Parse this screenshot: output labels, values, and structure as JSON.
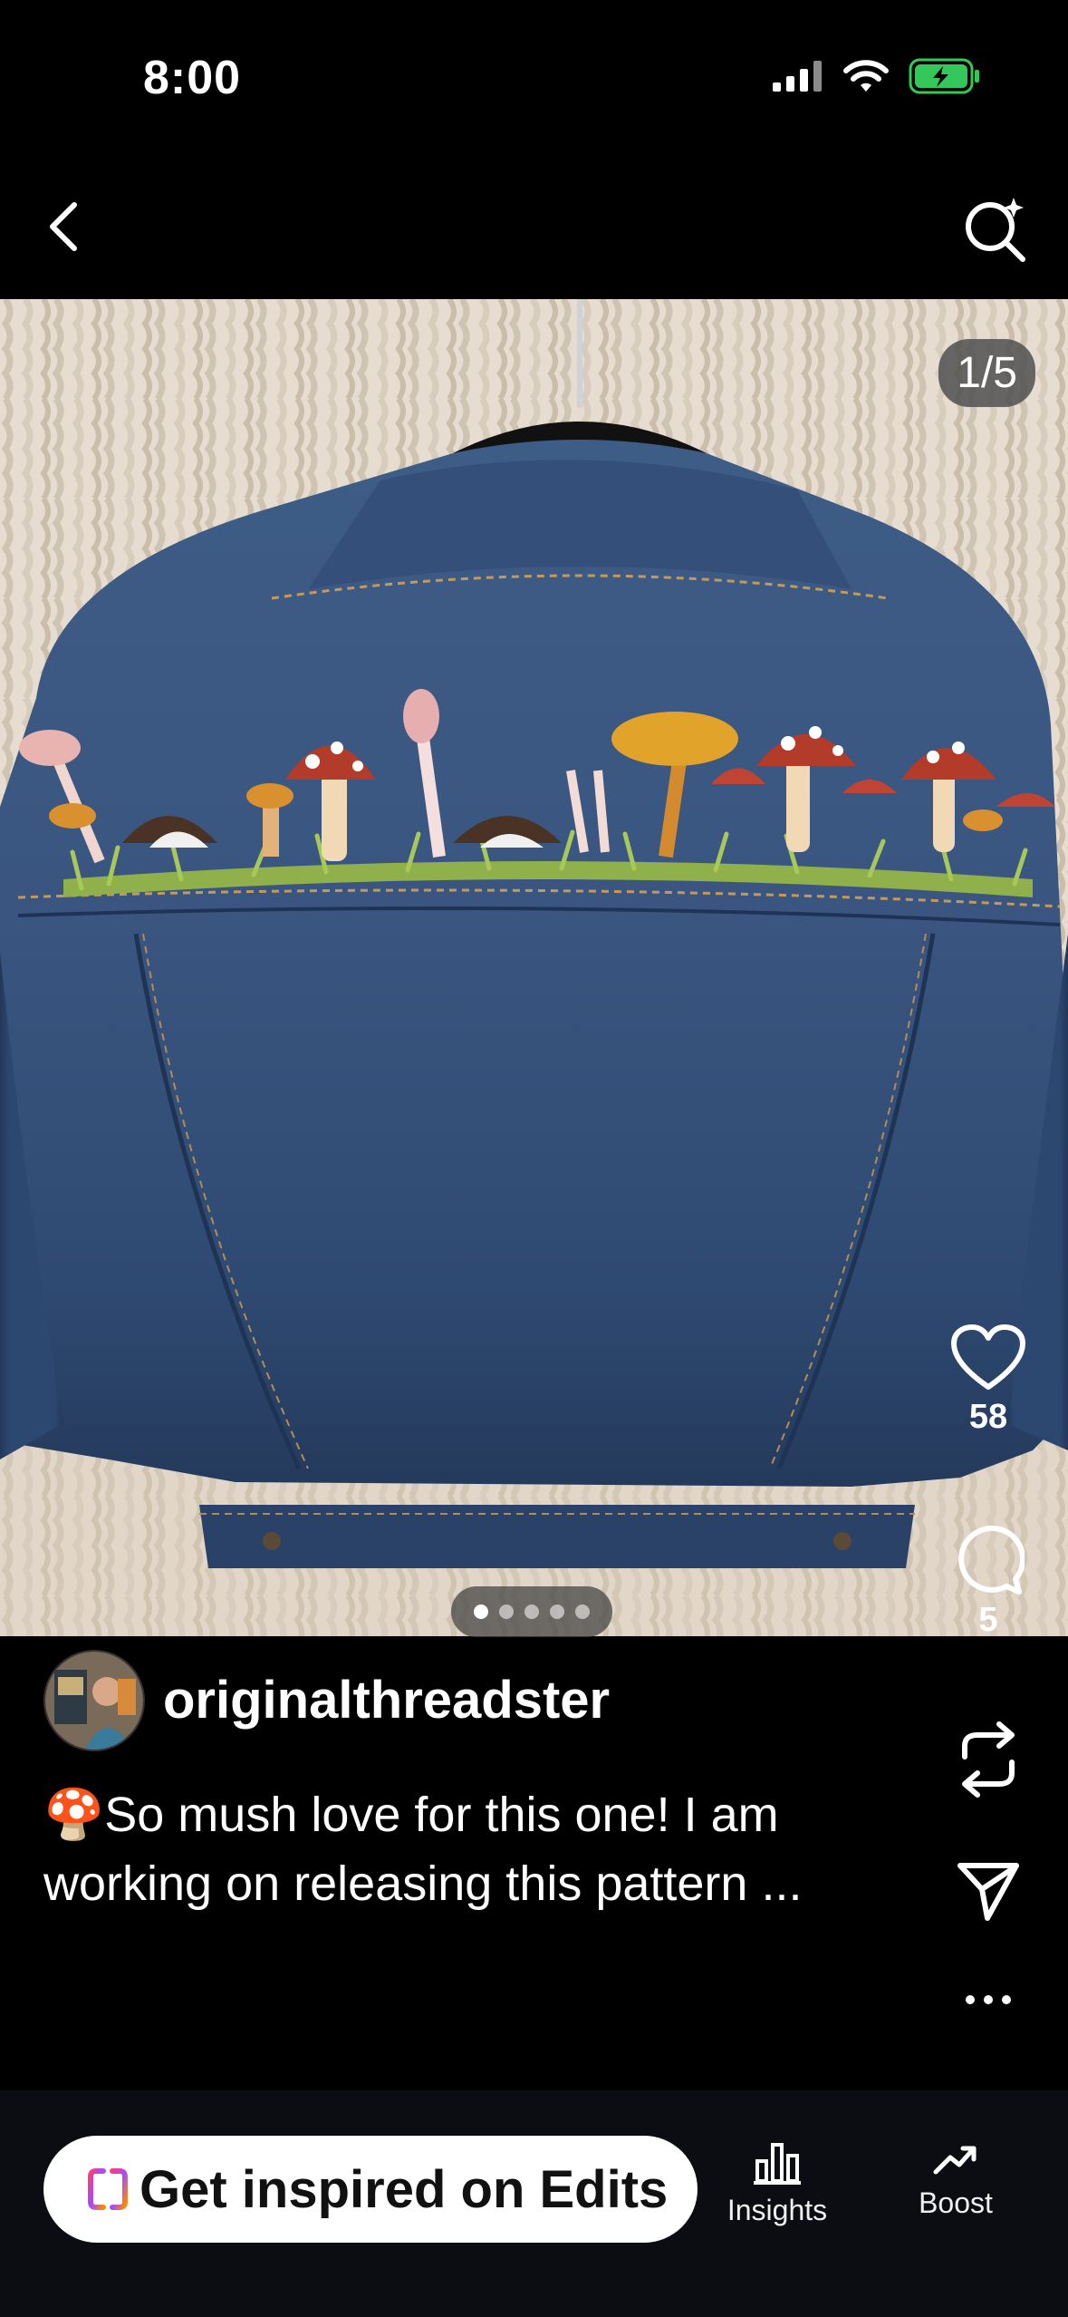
{
  "status_bar": {
    "time": "8:00"
  },
  "post": {
    "image_counter": "1/5",
    "carousel": {
      "total": 5,
      "active_index": 0
    },
    "author": "originalthreadster",
    "caption_emoji": "🍄",
    "caption_line1": "So mush love for this one! I am",
    "caption_line2": "working on releasing this pattern ..."
  },
  "actions": {
    "likes": "58",
    "comments": "5",
    "icons": [
      "heart-icon",
      "comment-icon",
      "repost-icon",
      "share-icon",
      "more-icon"
    ]
  },
  "bottom_bar": {
    "edits_label": "Get inspired on Edits",
    "insights_label": "Insights",
    "boost_label": "Boost"
  },
  "colors": {
    "background": "#000000",
    "battery": "#34c759",
    "edits_gradient": [
      "#ff3b7f",
      "#a34dff",
      "#ff8a00"
    ]
  }
}
